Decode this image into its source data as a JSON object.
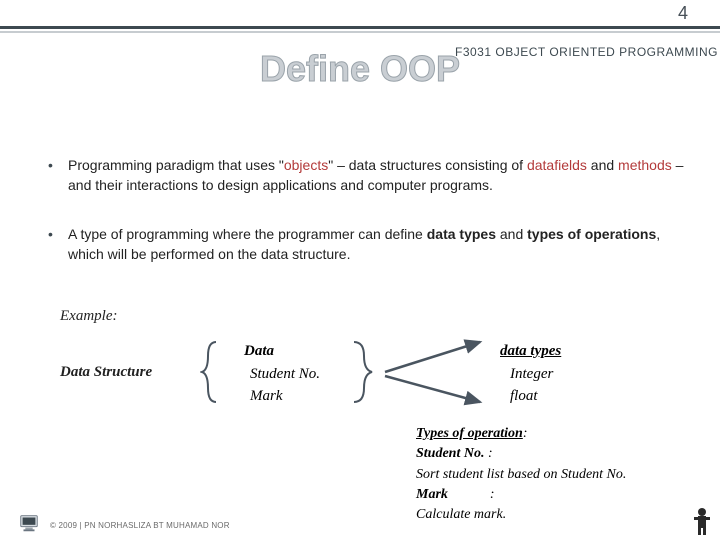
{
  "page_number": "4",
  "course_label": "F3031 OBJECT ORIENTED PROGRAMMING",
  "title": "Define OOP",
  "bullets": [
    {
      "pre": "Programming paradigm that uses \"",
      "red1": "objects",
      "mid1": "\" – data structures consisting of ",
      "red2": "datafields",
      "mid2": " and ",
      "red3": "methods",
      "post": " – and their interactions to design applications and computer programs."
    },
    {
      "pre": "A type of programming where the programmer can define ",
      "b1": "data types",
      "mid1": " and ",
      "b2": "types of operations",
      "post": ", which will be performed on the data structure."
    }
  ],
  "example_label": "Example:",
  "data_structure_label": "Data Structure",
  "data_col": {
    "header": "Data",
    "rows": [
      "Student No.",
      "Mark"
    ]
  },
  "types_col": {
    "header": "data types",
    "rows": [
      "Integer",
      "float"
    ]
  },
  "ops": {
    "header": "Types of operation",
    "colon": ":",
    "l1a": "Student No.",
    "l1b": " :",
    "l2": "Sort student list based on Student No.",
    "l3a": "Mark",
    "l3b": "            :",
    "l4": "Calculate mark."
  },
  "footer_text": "© 2009 | PN NORHASLIZA BT MUHAMAD NOR"
}
